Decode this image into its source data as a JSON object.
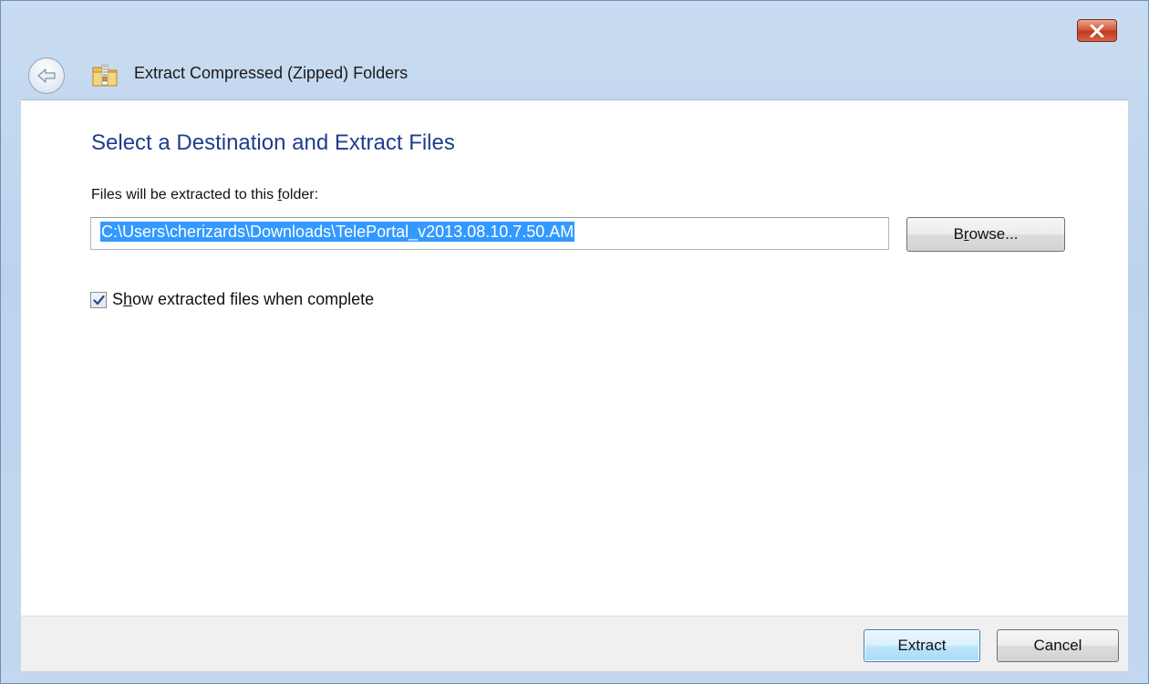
{
  "window": {
    "title": "Extract Compressed (Zipped) Folders"
  },
  "content": {
    "heading": "Select a Destination and Extract Files",
    "field_label_pre": "Files will be extracted to this ",
    "field_label_key": "f",
    "field_label_post": "older:",
    "path_value": "C:\\Users\\cherizards\\Downloads\\TelePortal_v2013.08.10.7.50.AM",
    "browse": {
      "pre": "B",
      "key": "r",
      "post": "owse..."
    },
    "checkbox": {
      "checked": true,
      "pre": "S",
      "key": "h",
      "post": "ow extracted files when complete"
    }
  },
  "footer": {
    "extract_label": "Extract",
    "cancel_label": "Cancel"
  },
  "icons": {
    "close": "close-icon",
    "back": "back-arrow-icon",
    "zip_folder": "zip-folder-icon",
    "checkmark": "checkmark-icon"
  },
  "colors": {
    "heading": "#1e3d8f",
    "selection": "#3399ff",
    "close_button": "#c23a1c",
    "default_button_border": "#3c7fb1"
  }
}
